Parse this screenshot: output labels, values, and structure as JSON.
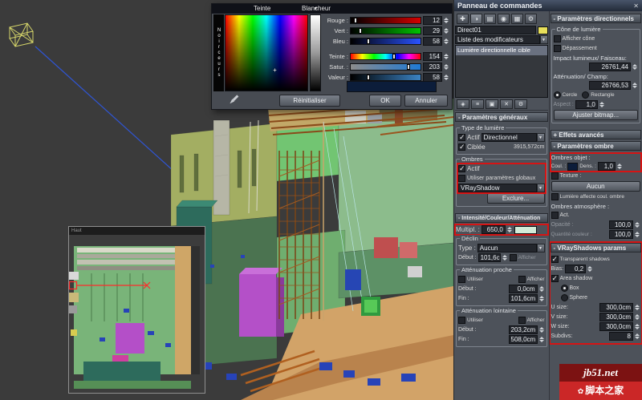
{
  "watermark": {
    "site": "jb51.net",
    "brand": "脚本之家"
  },
  "viewports": {
    "inset_label": "Haut"
  },
  "color_picker": {
    "hue_label": "Teinte",
    "whiteness_label": "Blancheur",
    "blackness_label": "Noirceurs",
    "sliders": [
      {
        "name": "rouge",
        "label": "Rouge :",
        "value": "12"
      },
      {
        "name": "vert",
        "label": "Vert :",
        "value": "29"
      },
      {
        "name": "bleu",
        "label": "Bleu :",
        "value": "58"
      },
      {
        "name": "teinte",
        "label": "Teinte :",
        "value": "154"
      },
      {
        "name": "satur",
        "label": "Satur. :",
        "value": "203"
      },
      {
        "name": "valeur",
        "label": "Valeur :",
        "value": "58"
      }
    ],
    "reset_button": "Réinitialiser",
    "ok_button": "OK",
    "cancel_button": "Annuler"
  },
  "panel": {
    "title": "Panneau de commandes",
    "close_glyph": "✕",
    "tabs": [
      {
        "name": "create",
        "glyph": "✚"
      },
      {
        "name": "modify",
        "glyph": "◑"
      },
      {
        "name": "hierarchy",
        "glyph": "▤"
      },
      {
        "name": "motion",
        "glyph": "◉"
      },
      {
        "name": "display",
        "glyph": "▦"
      },
      {
        "name": "utilities",
        "glyph": "⚙"
      }
    ],
    "object_name": "Direct01",
    "modifier_list_label": "Liste des modificateurs",
    "stack_item": "Lumière directionnelle cible",
    "stack_tools": [
      {
        "name": "pin-stack",
        "glyph": "◈"
      },
      {
        "name": "show-end-result",
        "glyph": "≡"
      },
      {
        "name": "make-unique",
        "glyph": "▣"
      },
      {
        "name": "remove-modifier",
        "glyph": "✕"
      },
      {
        "name": "configure",
        "glyph": "⚙"
      }
    ],
    "general": {
      "header": "- Paramètres généraux",
      "light_type_group": "Type de lumière",
      "on_label": "Actif",
      "type_value": "Directionnel",
      "targeted_label": "Ciblée",
      "target_distance": "3915,572cm",
      "shadows_group": "Ombres",
      "shadows_on_label": "Actif",
      "use_global_label": "Utiliser paramètres globaux",
      "shadow_type_value": "VRayShadow",
      "exclude_button": "Exclure..."
    },
    "intensity": {
      "header": "- Intensité/Couleur/Atténuation",
      "multiplier_label": "Multipl. :",
      "multiplier_value": "650,0",
      "decay_group": "Déclin",
      "type_label": "Type :",
      "type_value": "Aucun",
      "start_label": "Début :",
      "start_value": "101,6c",
      "show_label": "Afficher",
      "near_group": "Atténuation proche",
      "near_use_label": "Utiliser",
      "near_show_label": "Afficher",
      "near_start_label": "Début :",
      "near_start_value": "0,0cm",
      "near_end_label": "Fin :",
      "near_end_value": "101,6cm",
      "far_group": "Atténuation lointaine",
      "far_use_label": "Utiliser",
      "far_show_label": "Afficher",
      "far_start_label": "Début :",
      "far_start_value": "203,2cm",
      "far_end_label": "Fin :",
      "far_end_value": "508,0cm"
    },
    "directional": {
      "header": "- Paramètres directionnels",
      "cone_group": "Cône de lumière",
      "show_cone_label": "Afficher cône",
      "overshoot_label": "Dépassement",
      "hotspot_label": "Impact lumineux/ Faisceau:",
      "hotspot_value": "26761,44",
      "falloff_label": "Atténuation/ Champ:",
      "falloff_value": "26766,53",
      "circle_label": "Cercle",
      "rectangle_label": "Rectangle",
      "aspect_label": "Aspect :",
      "aspect_value": "1,0",
      "bitmap_fit_button": "Ajuster bitmap..."
    },
    "advanced": {
      "header": "+ Effets avancés"
    },
    "shadow": {
      "header": "- Paramètres ombre",
      "object_shadows_label": "Ombres objet :",
      "color_label": "Coul. :",
      "density_label": "Dens. :",
      "density_value": "1,0",
      "map_label": "Texture :",
      "map_button": "Aucun",
      "light_affects_label": "Lumière affecte coul. ombre",
      "atmosphere_label": "Ombres atmosphère :",
      "on_label": "Act.",
      "opacity_label": "Opacité :",
      "opacity_value": "100,0",
      "amount_label": "Quantité couleur :",
      "amount_value": "100,0"
    },
    "vray": {
      "header": "- VRayShadows params",
      "transparent_label": "Transparent shadows",
      "bias_label": "Bias:",
      "bias_value": "0,2",
      "area_label": "Area shadow",
      "box_label": "Box",
      "sphere_label": "Sphere",
      "u_label": "U size:",
      "u_value": "300,0cm",
      "v_label": "V size:",
      "v_value": "300,0cm",
      "w_label": "W size:",
      "w_value": "300,0cm",
      "subdivs_label": "Subdivs:",
      "subdivs_value": "8"
    }
  },
  "colors": {
    "annotation": "#d61414",
    "shadow_color": "#0c1d3a",
    "light_color": "#e8df5a",
    "multiplier_swatch": "#d2ead8",
    "picker_preview": "#0c1d3a"
  }
}
